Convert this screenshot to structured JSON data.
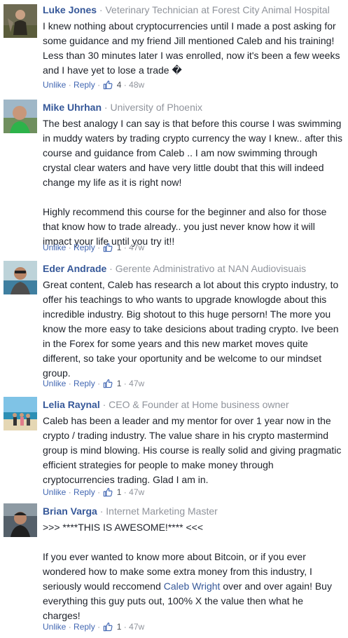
{
  "comments": [
    {
      "author": "Luke Jones",
      "subtitle": "Veterinary Technician at Forest City Animal Hospital",
      "paragraphs": [
        "I knew nothing about cryptocurrencies until I made a post asking for some guidance and my friend Jill mentioned Caleb and his training! Less than 30 minutes later I was enrolled, now it's been a few weeks and I have yet to lose a trade �"
      ],
      "actions": {
        "unlike": "Unlike",
        "reply": "Reply",
        "likes": "4",
        "time": "48w"
      }
    },
    {
      "author": "Mike Uhrhan",
      "subtitle": "University of Phoenix",
      "paragraphs": [
        "The best analogy I can say is that before this course I was swimming in muddy waters by trading crypto currency the way I knew.. after this course and guidance from Caleb .. I am now swimming through crystal clear waters and have very little doubt that this will indeed change my life as it is right now!",
        "Highly recommend this course for the beginner and also for those that know how to trade already.. you just never know how it will impact your life until you try it!!"
      ],
      "actions": {
        "unlike": "Unlike",
        "reply": "Reply",
        "likes": "1",
        "time": "47w"
      }
    },
    {
      "author": "Eder Andrade",
      "subtitle": "Gerente Administrativo at NAN Audiovisuais",
      "paragraphs": [
        "Great content, Caleb has research a lot about this crypto industry, to offer his teachings to who wants to upgrade knowlogde about this incredible industry. Big shotout to this huge persorn! The more you know the more easy to take desicions about trading crypto. Ive been in the Forex for some years and this new market moves quite different, so take your oportunity and be welcome to our mindset group."
      ],
      "actions": {
        "unlike": "Unlike",
        "reply": "Reply",
        "likes": "1",
        "time": "47w"
      }
    },
    {
      "author": "Lelia Raynal",
      "subtitle": "CEO & Founder at Home business owner",
      "paragraphs": [
        "Caleb has been a leader and my mentor for over 1 year now in the crypto / trading industry. The value share in his crypto mastermind group is mind blowing. His course is really solid and giving pragmatic efficient strategies for people to make money through cryptocurrencies trading. Glad I am in."
      ],
      "actions": {
        "unlike": "Unlike",
        "reply": "Reply",
        "likes": "1",
        "time": "47w"
      }
    },
    {
      "author": "Brian Varga",
      "subtitle": "Internet Marketing Master",
      "paragraphs": [
        ">>> ****THIS IS AWESOME!**** <<<",
        "If you ever wanted to know more about Bitcoin, or if you ever wondered how to make some extra money from this industry, I seriously would reccomend",
        "Caleb Wright",
        "over and over again! Buy everything this guy puts out, 100% X the value then what he charges!"
      ],
      "actions": {
        "unlike": "Unlike",
        "reply": "Reply",
        "likes": "1",
        "time": "47w"
      }
    }
  ],
  "separator": "·",
  "icons": {
    "like": "thumbs-up-icon",
    "avatar": "avatar-photo"
  },
  "colors": {
    "link": "#365899",
    "meta": "#90949c",
    "action": "#4267b2",
    "text": "#1d2129"
  }
}
